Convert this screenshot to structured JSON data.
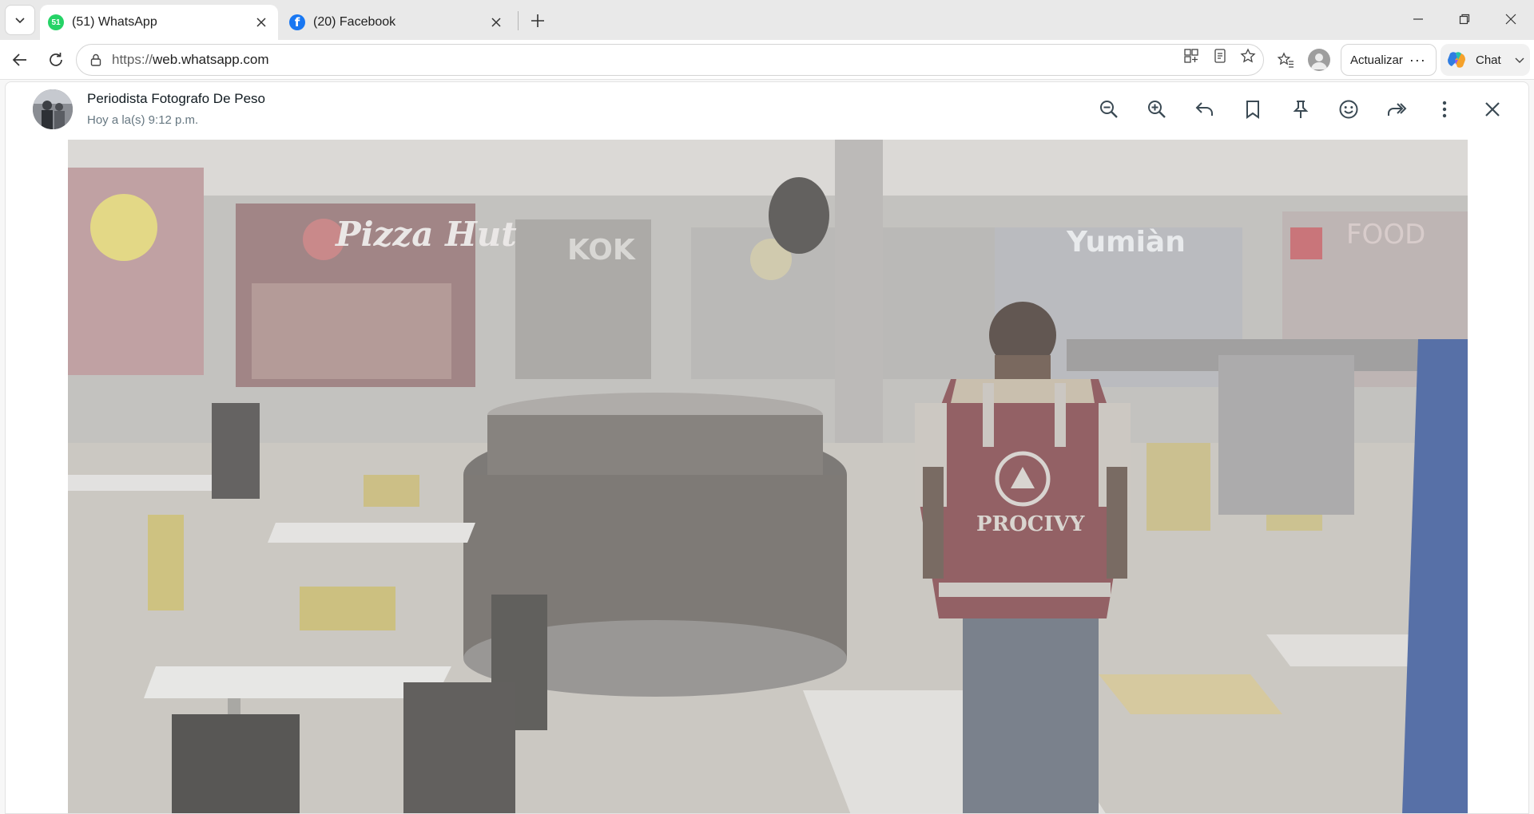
{
  "browser": {
    "tabs": [
      {
        "title": "(51) WhatsApp",
        "favicon": "whatsapp-icon",
        "badge": "51",
        "active": true
      },
      {
        "title": "(20) Facebook",
        "favicon": "facebook-icon",
        "active": false
      }
    ],
    "address": {
      "url_prefix": "https://",
      "url_host": "web.whatsapp.com"
    },
    "update_label": "Actualizar",
    "chat_label": "Chat"
  },
  "viewer": {
    "sender_name": "Periodista Fotografo De Peso",
    "timestamp": "Hoy a la(s) 9:12 p.m.",
    "actions": [
      "zoom-out-icon",
      "zoom-in-icon",
      "reply-icon",
      "bookmark-icon",
      "pin-icon",
      "emoji-icon",
      "forward-icon",
      "more-icon",
      "close-icon"
    ],
    "photo": {
      "signs": [
        "Pizza Hut",
        "KOK",
        "Yumiàn",
        "FOOD",
        "PROCIVY"
      ]
    }
  },
  "colors": {
    "whatsapp_green": "#25d366",
    "facebook_blue": "#1877f2",
    "vest_red": "#7d3a40"
  }
}
